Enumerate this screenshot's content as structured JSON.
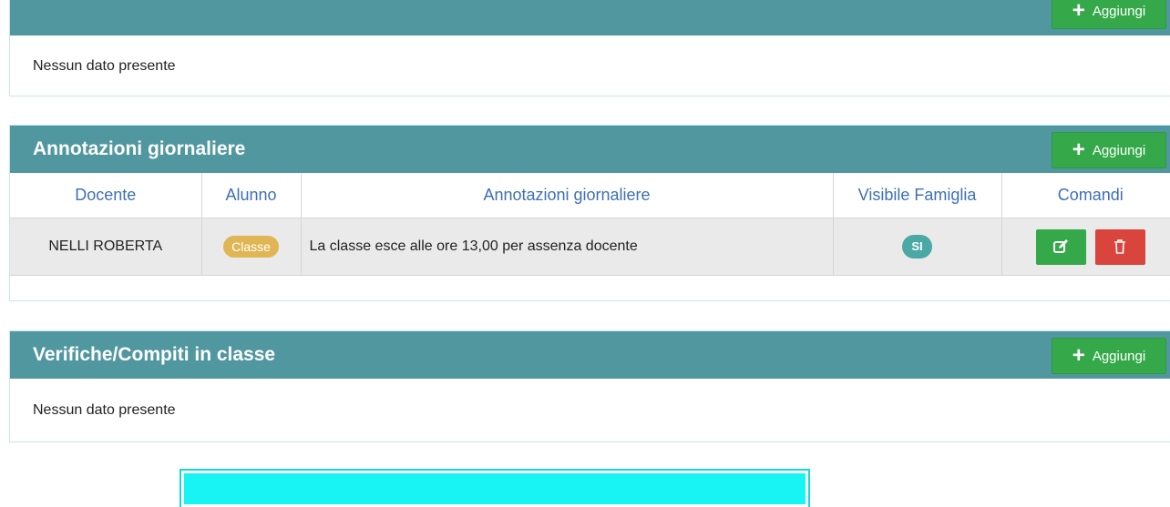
{
  "panels": {
    "top": {
      "add_label": "Aggiungi",
      "empty_text": "Nessun dato presente"
    },
    "annotazioni": {
      "title": "Annotazioni giornaliere",
      "add_label": "Aggiungi",
      "columns": [
        "Docente",
        "Alunno",
        "Annotazioni giornaliere",
        "Visibile Famiglia",
        "Comandi"
      ],
      "rows": [
        {
          "docente": "NELLI ROBERTA",
          "alunno_badge": "Classe",
          "annotazione": "La classe esce alle ore 13,00 per assenza docente",
          "visibile": "SI"
        }
      ]
    },
    "verifiche": {
      "title": "Verifiche/Compiti in classe",
      "add_label": "Aggiungi",
      "empty_text": "Nessun dato presente"
    }
  },
  "icons": {
    "add": "plus-icon",
    "edit": "edit-icon",
    "delete": "trash-icon"
  },
  "colors": {
    "panel_header": "#5097a0",
    "add_button": "#35a94a",
    "delete_button": "#d9453d",
    "badge_classe": "#e0b654",
    "badge_si": "#4aa8a5",
    "column_header_text": "#3e70b6",
    "highlight_box": "#18f3f3"
  }
}
